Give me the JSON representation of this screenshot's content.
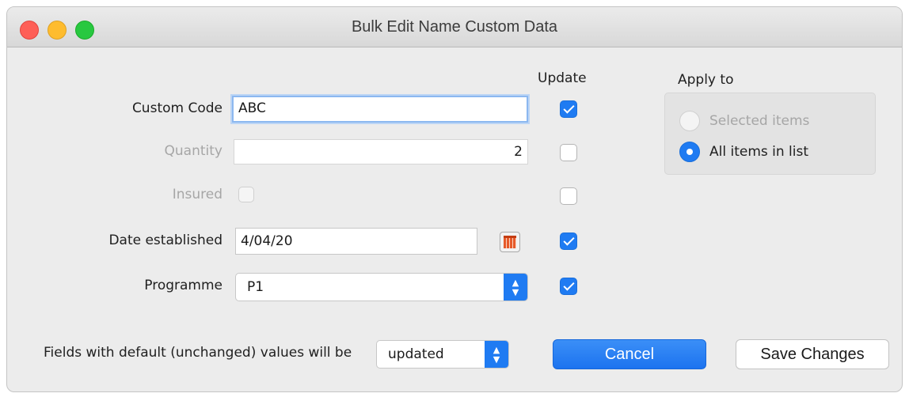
{
  "window": {
    "title": "Bulk Edit Name Custom Data"
  },
  "columns": {
    "update": "Update"
  },
  "fields": {
    "custom_code": {
      "label": "Custom Code",
      "value": "ABC",
      "update": true
    },
    "quantity": {
      "label": "Quantity",
      "value": "2",
      "update": false
    },
    "insured": {
      "label": "Insured",
      "update": false
    },
    "date_established": {
      "label": "Date established",
      "value": "4/04/20",
      "update": true
    },
    "programme": {
      "label": "Programme",
      "value": "P1",
      "update": true
    }
  },
  "apply_to": {
    "title": "Apply to",
    "options": [
      {
        "label": "Selected items",
        "selected": false,
        "enabled": false
      },
      {
        "label": "All items in list",
        "selected": true,
        "enabled": true
      }
    ]
  },
  "footer": {
    "defaults_label": "Fields with default (unchanged) values will be",
    "defaults_value": "updated",
    "cancel_label": "Cancel",
    "save_label": "Save Changes"
  },
  "colors": {
    "accent": "#1f7bf2",
    "window_bg": "#ececec"
  },
  "icons": {
    "close": "close-icon",
    "minimize": "minimize-icon",
    "maximize": "maximize-icon",
    "calendar": "calendar-icon",
    "stepper": "chevron-up-down-icon"
  }
}
